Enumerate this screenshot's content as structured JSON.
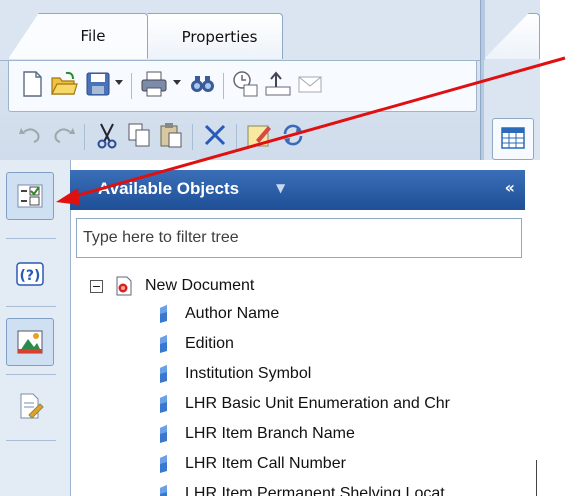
{
  "ribbon": {
    "tabs": [
      {
        "label": "File",
        "active": true
      },
      {
        "label": "Properties",
        "active": false
      }
    ],
    "toolbar_row1": [
      "new-document-icon",
      "open-folder-icon",
      "save-icon",
      "print-icon",
      "find-icon",
      "refresh-document-icon",
      "export-icon",
      "send-mail-icon"
    ],
    "toolbar_row2": [
      "undo-icon",
      "redo-icon",
      "cut-icon",
      "copy-icon",
      "paste-icon",
      "delete-icon",
      "edit-query-icon",
      "refresh-icon"
    ]
  },
  "side_rail": {
    "buttons": [
      "available-objects-icon",
      "help-icon",
      "image-icon",
      "edit-document-icon"
    ]
  },
  "objects_panel": {
    "title": "Available Objects",
    "dropdown_glyph": "▼",
    "collapse_glyph": "«",
    "filter_placeholder": "Type here to filter tree",
    "root_label": "New Document",
    "items": [
      "Author Name",
      "Edition",
      "Institution Symbol",
      "LHR Basic Unit Enumeration and Chr",
      "LHR Item Branch Name",
      "LHR Item Call Number",
      "LHR Item Permanent Shelving Locat"
    ]
  },
  "colors": {
    "panel_header": "#2a5ea8",
    "annotation_arrow": "#e01010",
    "ribbon_bg": "#dbe5f1"
  }
}
